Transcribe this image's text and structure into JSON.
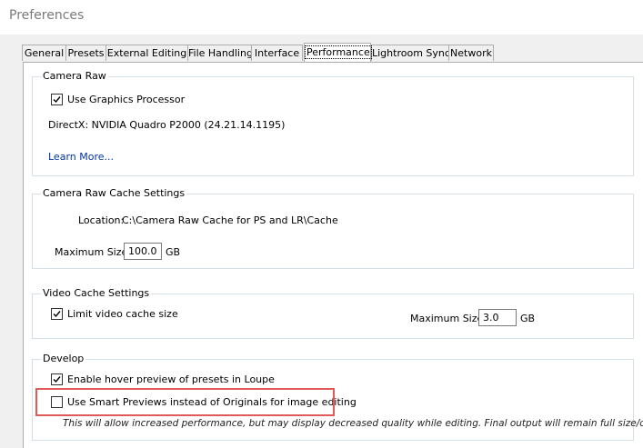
{
  "window": {
    "title": "Preferences"
  },
  "tabs": [
    {
      "label": "General"
    },
    {
      "label": "Presets"
    },
    {
      "label": "External Editing"
    },
    {
      "label": "File Handling"
    },
    {
      "label": "Interface"
    },
    {
      "label": "Performance",
      "active": true
    },
    {
      "label": "Lightroom Sync"
    },
    {
      "label": "Network"
    }
  ],
  "camera_raw": {
    "legend": "Camera Raw",
    "use_gpu_label": "Use Graphics Processor",
    "use_gpu_checked": true,
    "directx_text": "DirectX: NVIDIA Quadro P2000 (24.21.14.1195)",
    "learn_more": "Learn More..."
  },
  "cache_settings": {
    "legend": "Camera Raw Cache Settings",
    "location_label": "Location:",
    "location_value": "C:\\Camera Raw Cache for PS and LR\\Cache",
    "max_size_label": "Maximum Size:",
    "max_size_value": "100.0",
    "unit": "GB"
  },
  "video_cache": {
    "legend": "Video Cache Settings",
    "limit_label": "Limit video cache size",
    "limit_checked": true,
    "max_size_label": "Maximum Size:",
    "max_size_value": "3.0",
    "unit": "GB"
  },
  "develop": {
    "legend": "Develop",
    "hover_label": "Enable hover preview of presets in Loupe",
    "hover_checked": true,
    "smart_previews_label": "Use Smart Previews instead of Originals for image editing",
    "smart_previews_checked": false,
    "note": "This will allow increased performance, but may display decreased quality while editing. Final output will remain full size/quality."
  },
  "colors": {
    "highlight": "#e05a5a",
    "link": "#0033a8"
  }
}
